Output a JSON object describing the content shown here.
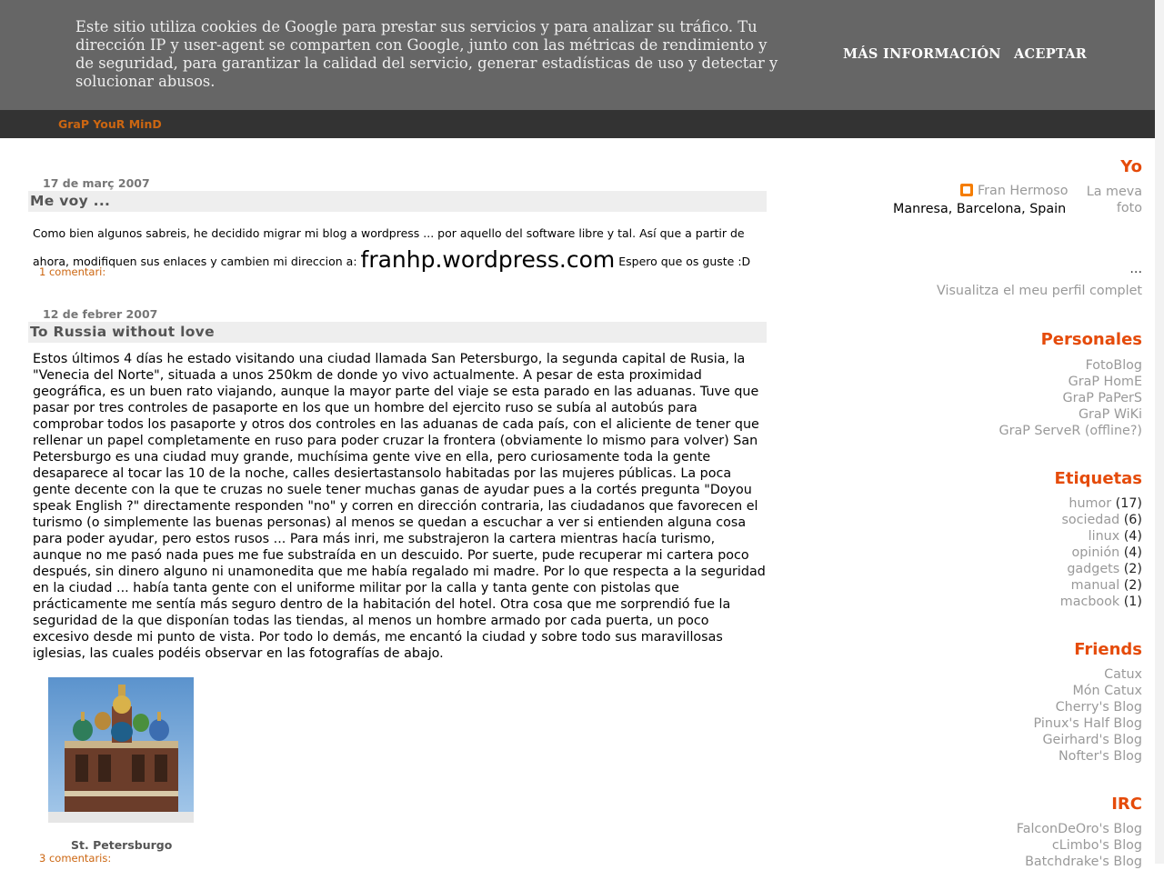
{
  "cookie_banner": {
    "text": "Este sitio utiliza cookies de Google para prestar sus servicios y para analizar su tráfico. Tu dirección IP y user-agent se comparten con Google, junto con las métricas de rendimiento y de seguridad, para garantizar la calidad del servicio, generar estadísticas de uso y detectar y solucionar abusos.",
    "more_info": "MÁS INFORMACIÓN",
    "accept": "ACEPTAR"
  },
  "blog": {
    "title": "GraP YouR MinD"
  },
  "posts": [
    {
      "date": "17 de març 2007",
      "title": "Me voy ...",
      "body_before": "Como bien algunos sabreis, he decidido migrar mi blog a wordpress ... por aquello del software libre y tal. Así que a partir de ahora, modifiquen sus enlaces y cambien mi direccion a: ",
      "big_link": "franhp.wordpress.com",
      "body_after": " Espero que os guste :D",
      "comments": "1 comentari:"
    },
    {
      "date": "12 de febrer 2007",
      "title": "To Russia without love",
      "body": "Estos últimos 4 días he estado visitando una ciudad llamada San Petersburgo, la segunda capital de Rusia, la \"Venecia del Norte\", situada a unos 250km de donde yo vivo actualmente. A pesar de esta proximidad geográfica, es un buen rato viajando, aunque la mayor parte del viaje se esta parado en las aduanas. Tuve que pasar por tres controles de pasaporte en los que un hombre del ejercito ruso se subía al autobús para comprobar todos los pasaporte y otros dos controles en las aduanas de cada país, con el aliciente de tener que rellenar un papel completamente en ruso para poder cruzar la frontera (obviamente lo mismo para volver) San Petersburgo es una ciudad muy grande, muchísima gente vive en ella, pero curiosamente toda la gente desaparece al tocar las 10 de la noche, calles desiertastansolo habitadas por las mujeres públicas. La poca gente decente con la que te cruzas no suele tener muchas ganas de ayudar pues a la cortés pregunta \"Doyou speak English ?\" directamente responden \"no\" y corren en dirección contraria, las ciudadanos que favorecen el turismo (o simplemente las buenas personas) al menos se quedan a escuchar a ver si entienden alguna cosa para poder ayudar, pero estos rusos ... Para más inri, me substrajeron la cartera mientras hacía turismo, aunque no me pasó nada pues me fue substraída en un descuido. Por suerte, pude recuperar mi cartera poco después, sin dinero alguno ni unamonedita que me había regalado mi madre. Por lo que respecta a la seguridad en la ciudad ... había tanta gente con el uniforme militar por la calla y tanta gente con pistolas que prácticamente me sentía más seguro dentro de la habitación del hotel. Otra cosa que me sorprendió fue la seguridad de la que disponían todas las tiendas, al menos un hombre armado por cada puerta, un poco excesivo desde mi punto de vista. Por todo lo demás, me encantó la ciudad y sobre todo sus maravillosas iglesias, las cuales podéis observar en las fotografías de abajo.",
      "photo_caption": "St. Petersburgo",
      "comments": "3 comentaris:"
    }
  ],
  "sidebar": {
    "profile": {
      "heading": "Yo",
      "name": "Fran Hermoso",
      "location": "Manresa, Barcelona, Spain",
      "photo_link": "La meva foto",
      "ellipsis": "...",
      "full_profile": "Visualitza el meu perfil complet"
    },
    "personales": {
      "heading": "Personales",
      "links": [
        "FotoBlog",
        "GraP HomE",
        "GraP PaPerS",
        "GraP WiKi",
        "GraP ServeR (offline?)"
      ]
    },
    "etiquetas": {
      "heading": "Etiquetas",
      "items": [
        {
          "label": "humor",
          "count": "(17)"
        },
        {
          "label": "sociedad",
          "count": "(6)"
        },
        {
          "label": "linux",
          "count": "(4)"
        },
        {
          "label": "opinión",
          "count": "(4)"
        },
        {
          "label": "gadgets",
          "count": "(2)"
        },
        {
          "label": "manual",
          "count": "(2)"
        },
        {
          "label": "macbook",
          "count": "(1)"
        }
      ]
    },
    "friends": {
      "heading": "Friends",
      "links": [
        "Catux",
        "Món Catux",
        "Cherry's Blog",
        "Pinux's Half Blog",
        "Geirhard's Blog",
        "Nofter's Blog"
      ]
    },
    "irc": {
      "heading": "IRC",
      "links": [
        "FalconDeOro's Blog",
        "cLimbo's Blog",
        "Batchdrake's Blog"
      ]
    }
  }
}
